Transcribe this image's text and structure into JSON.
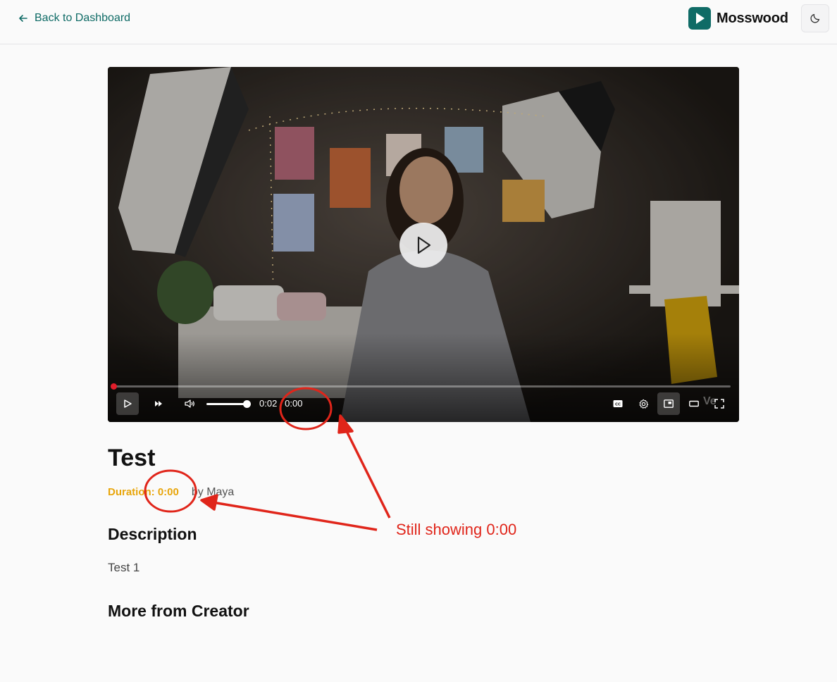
{
  "header": {
    "back_label": "Back to Dashboard",
    "brand_name": "Mosswood",
    "theme_toggle_icon": "moon-icon"
  },
  "player": {
    "current_time": "0:02",
    "separator": "/",
    "total_time": "0:00",
    "time_display": "0:02 / 0:00",
    "watermark": "Ve",
    "progress_fraction": 0.0,
    "volume_fraction": 1.0,
    "controls": [
      "play-icon",
      "fast-forward-icon",
      "volume-icon",
      "captions-icon",
      "settings-icon",
      "picture-in-picture-icon",
      "theater-mode-icon",
      "fullscreen-icon"
    ]
  },
  "video_meta": {
    "title": "Test",
    "duration_label": "Duration: 0:00",
    "byline": "by Maya"
  },
  "sections": {
    "description_heading": "Description",
    "description_text": "Test 1",
    "more_heading": "More from Creator"
  },
  "annotation": {
    "note": "Still showing 0:00",
    "color": "#e0251a"
  },
  "colors": {
    "accent": "#0f6b66",
    "duration": "#e8a50a",
    "progress": "#e11d2a"
  }
}
